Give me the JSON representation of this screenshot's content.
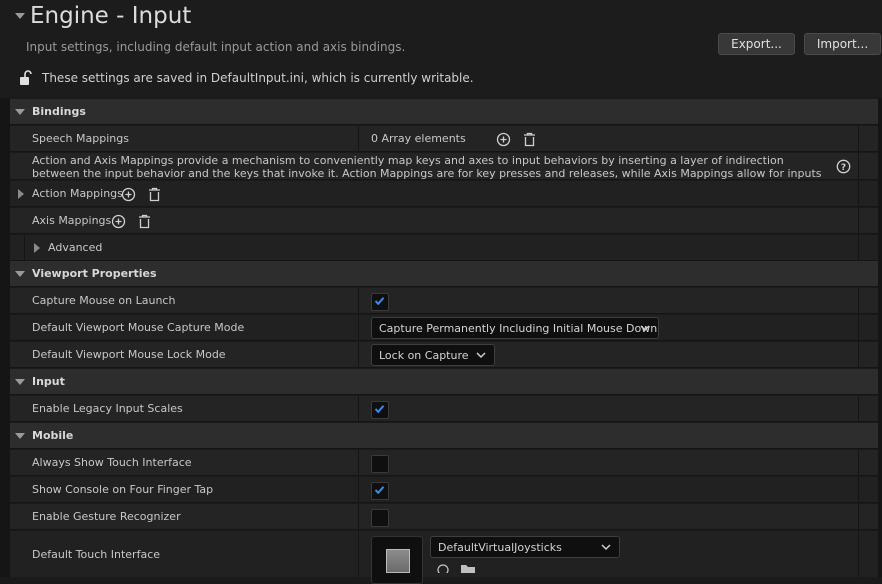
{
  "header": {
    "title": "Engine - Input",
    "subtitle": "Input settings, including default input action and axis bindings.",
    "save_note": "These settings are saved in DefaultInput.ini, which is currently writable.",
    "export_label": "Export...",
    "import_label": "Import..."
  },
  "bindings": {
    "category": "Bindings",
    "speech_mappings": {
      "label": "Speech Mappings",
      "value": "0 Array elements"
    },
    "description": "Action and Axis Mappings provide a mechanism to conveniently map keys and axes to input behaviors by inserting a layer of indirection between the input behavior and the keys that invoke it. Action Mappings are for key presses and releases, while Axis Mappings allow for inputs that have a continuous range.",
    "action_mappings": "Action Mappings",
    "axis_mappings": "Axis Mappings",
    "advanced": "Advanced"
  },
  "viewport": {
    "category": "Viewport Properties",
    "capture_mouse": {
      "label": "Capture Mouse on Launch",
      "checked": true
    },
    "capture_mode": {
      "label": "Default Viewport Mouse Capture Mode",
      "value": "Capture Permanently Including Initial Mouse Down"
    },
    "lock_mode": {
      "label": "Default Viewport Mouse Lock Mode",
      "value": "Lock on Capture"
    }
  },
  "input": {
    "category": "Input",
    "legacy_scales": {
      "label": "Enable Legacy Input Scales",
      "checked": true
    }
  },
  "mobile": {
    "category": "Mobile",
    "always_touch": {
      "label": "Always Show Touch Interface",
      "checked": false
    },
    "console_tap": {
      "label": "Show Console on Four Finger Tap",
      "checked": true
    },
    "gesture": {
      "label": "Enable Gesture Recognizer",
      "checked": false
    },
    "touch_interface": {
      "label": "Default Touch Interface",
      "value": "DefaultVirtualJoysticks"
    }
  },
  "colors": {
    "accent": "#3b8be8",
    "background": "#1a1a1a",
    "category_bg": "#2d2d2d",
    "row_bg": "#242424"
  }
}
